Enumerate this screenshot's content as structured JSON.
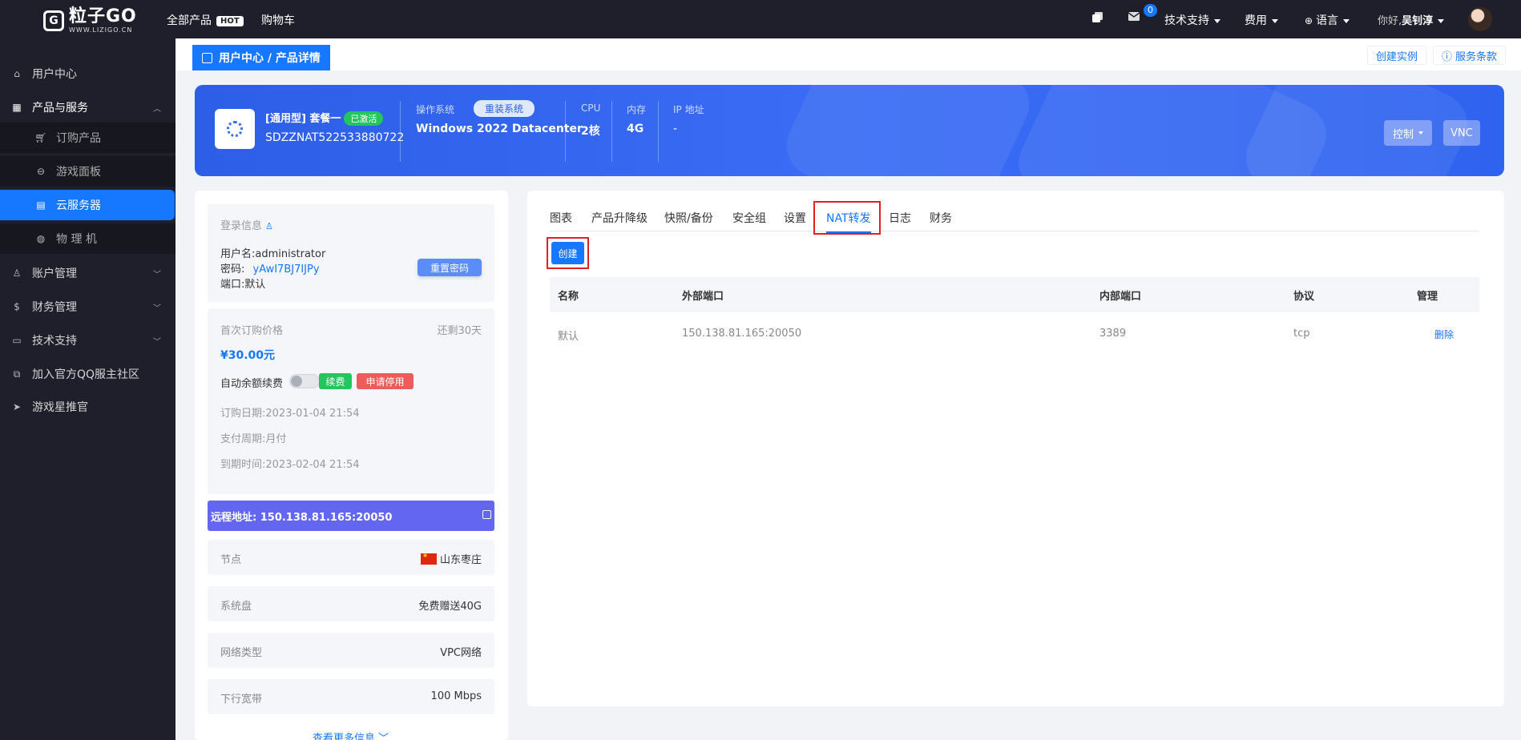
{
  "topbar": {
    "logo_text": "粒子GO",
    "logo_sub": "WWW.LIZIGO.CN",
    "nav": [
      {
        "label": "全部产品",
        "badge": "HOT"
      },
      {
        "label": "购物车"
      }
    ],
    "message_count": "0",
    "tech_support": "技术支持",
    "fees": "费用",
    "language": "语言",
    "greeting": "你好,",
    "username": "吴钊淳"
  },
  "sidebar": {
    "items": [
      {
        "label": "用户中心",
        "icon": "home-icon"
      },
      {
        "label": "产品与服务",
        "icon": "grid-icon",
        "expanded": true
      },
      {
        "label": "订购产品",
        "icon": "cart-icon"
      },
      {
        "label": "游戏面板",
        "icon": "gamepad-icon"
      },
      {
        "label": "云服务器",
        "icon": "server-icon",
        "active": true
      },
      {
        "label": "物 理 机",
        "icon": "globe-icon"
      },
      {
        "label": "账户管理",
        "icon": "user-icon"
      },
      {
        "label": "财务管理",
        "icon": "dollar-icon"
      },
      {
        "label": "技术支持",
        "icon": "ticket-icon"
      },
      {
        "label": "加入官方QQ服主社区",
        "icon": "link-icon"
      },
      {
        "label": "游戏星推官",
        "icon": "send-icon"
      }
    ]
  },
  "breadcrumb": "用户中心 / 产品详情",
  "header_links": {
    "create_instance": "创建实例",
    "terms": "服务条款"
  },
  "banner": {
    "title": "[通用型] 套餐一",
    "status": "已激活",
    "code": "SDZZNAT522533880722",
    "os_label": "操作系统",
    "reinstall": "重装系统",
    "os_value": "Windows 2022 Datacenter",
    "cpu_label": "CPU",
    "cpu_value": "2核",
    "mem_label": "内存",
    "mem_value": "4G",
    "ip_label": "IP 地址",
    "ip_value": "-",
    "control_btn": "控制",
    "vnc_btn": "VNC"
  },
  "login_info": {
    "title": "登录信息",
    "username_label": "用户名:",
    "username": "administrator",
    "password_label": "密码:",
    "password": "yAwI7BJ7IJPy",
    "port_label": "端口:",
    "port": "默认",
    "reset_btn": "重置密码"
  },
  "billing": {
    "first_price_label": "首次订购价格",
    "remaining": "还剩30天",
    "price": "¥30.00元",
    "auto_renew_label": "自动余额续费",
    "renew_tag": "续费",
    "suspend_tag": "申请停用",
    "order_date": "订购日期:2023-01-04 21:54",
    "pay_cycle": "支付周期:月付",
    "expire": "到期时间:2023-02-04 21:54"
  },
  "remote": "远程地址: 150.138.81.165:20050",
  "details": [
    {
      "key": "节点",
      "value": "山东枣庄"
    },
    {
      "key": "系统盘",
      "value": "免费赠送40G"
    },
    {
      "key": "网络类型",
      "value": "VPC网络"
    },
    {
      "key": "下行宽带",
      "value": "100 Mbps"
    }
  ],
  "more_info": "查看更多信息",
  "tabs": [
    "图表",
    "产品升降级",
    "快照/备份",
    "安全组",
    "设置",
    "NAT转发",
    "日志",
    "财务"
  ],
  "create_btn": "创建",
  "nat_table": {
    "headers": [
      "名称",
      "外部端口",
      "内部端口",
      "协议",
      "管理"
    ],
    "rows": [
      {
        "name": "默认",
        "external": "150.138.81.165:20050",
        "internal": "3389",
        "protocol": "tcp",
        "action": "删除"
      }
    ]
  }
}
